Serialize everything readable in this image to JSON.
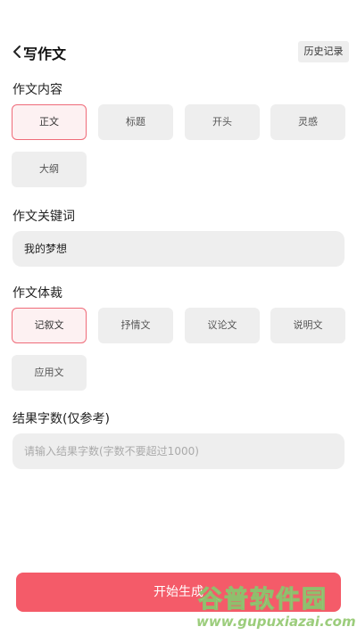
{
  "header": {
    "back_icon": "chevron-left-icon",
    "title": "写作文",
    "history_label": "历史记录"
  },
  "content": {
    "label": "作文内容",
    "options": [
      "正文",
      "标题",
      "开头",
      "灵感",
      "大纲"
    ],
    "selected": "正文"
  },
  "keyword": {
    "label": "作文关键词",
    "value": "我的梦想"
  },
  "genre": {
    "label": "作文体裁",
    "options": [
      "记叙文",
      "抒情文",
      "议论文",
      "说明文",
      "应用文"
    ],
    "selected": "记叙文"
  },
  "word_count": {
    "label": "结果字数(仅参考)",
    "placeholder": "请输入结果字数(字数不要超过1000)"
  },
  "generate_label": "开始生成",
  "watermark": {
    "main": "谷普软件园",
    "url": "www.gupuxiazai.com"
  },
  "colors": {
    "accent": "#f45b69",
    "chip_active_border": "#ef6b79",
    "chip_bg": "#eeeeee"
  }
}
